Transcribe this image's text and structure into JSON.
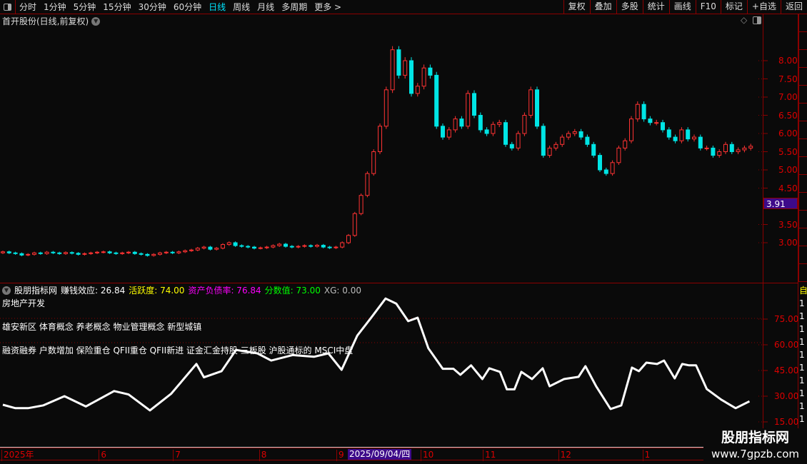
{
  "toolbar": {
    "periods": [
      "分时",
      "1分钟",
      "5分钟",
      "15分钟",
      "30分钟",
      "60分钟",
      "日线",
      "周线",
      "月线",
      "多周期",
      "更多 >"
    ],
    "active_period": "日线",
    "buttons": [
      "复权",
      "叠加",
      "多股",
      "统计",
      "画线",
      "F10",
      "标记",
      "+自选",
      "返回"
    ]
  },
  "stock_title": "首开股份(日线,前复权)",
  "price_axis": {
    "ticks": [
      "8.00",
      "7.50",
      "7.00",
      "6.50",
      "6.00",
      "5.50",
      "5.00",
      "4.50",
      "3.50",
      "3.00"
    ],
    "current": "3.91"
  },
  "indicator": {
    "name": "股朋指标网",
    "items": [
      {
        "label": "赚钱效应: 26.84",
        "color": "#ffffff"
      },
      {
        "label": "活跃度: 74.00",
        "color": "#ffff00"
      },
      {
        "label": "资产负债率: 76.84",
        "color": "#ff00ff"
      },
      {
        "label": "分数值: 73.00",
        "color": "#00ff00"
      },
      {
        "label": "XG: 0.00",
        "color": "#bbbbbb"
      }
    ],
    "lines": [
      "房地产开发",
      "雄安新区 体育概念 养老概念 物业管理概念 新型城镇",
      "融资融券 户数增加 保险重仓 QFII重仓 QFII新进 证金汇金持股 三板股 沪股通标的 MSCI中盘"
    ],
    "ticks": [
      "75.00",
      "60.00",
      "45.00",
      "30.00",
      "15.00"
    ],
    "right_col": [
      "自",
      "1",
      "1",
      "1",
      "1",
      "1",
      "1",
      "1",
      "1",
      "1",
      "1"
    ]
  },
  "time_axis": {
    "labels": [
      {
        "t": "2025年",
        "p": 0
      },
      {
        "t": "6",
        "p": 15.5
      },
      {
        "t": "7",
        "p": 27.3
      },
      {
        "t": "8",
        "p": 41
      },
      {
        "t": "9",
        "p": 53.3
      },
      {
        "t": "10",
        "p": 66.7
      },
      {
        "t": "11",
        "p": 76.6
      },
      {
        "t": "12",
        "p": 88.6
      },
      {
        "t": "1",
        "p": 102
      }
    ],
    "crosshair_date": "2025/09/04/四"
  },
  "watermark": {
    "title": "股朋指标网",
    "url": "www.7gpzb.com"
  },
  "colors": {
    "up": "#ff3333",
    "down": "#00e5e5",
    "accent": "#00e5ff",
    "grid": "#8b0000",
    "highlight": "#3d0a8a"
  },
  "chart_data": {
    "type": "candlestick",
    "closes": [
      2.75,
      2.72,
      2.7,
      2.66,
      2.68,
      2.72,
      2.7,
      2.74,
      2.72,
      2.7,
      2.73,
      2.71,
      2.68,
      2.7,
      2.72,
      2.74,
      2.75,
      2.72,
      2.7,
      2.72,
      2.74,
      2.7,
      2.68,
      2.65,
      2.68,
      2.72,
      2.74,
      2.72,
      2.75,
      2.78,
      2.8,
      2.85,
      2.88,
      2.82,
      2.85,
      2.95,
      3.0,
      2.92,
      2.9,
      2.88,
      2.85,
      2.86,
      2.88,
      2.92,
      2.96,
      2.9,
      2.88,
      2.9,
      2.92,
      2.9,
      2.93,
      2.88,
      2.86,
      2.88,
      3.0,
      3.2,
      3.8,
      4.3,
      4.9,
      5.5,
      6.2,
      7.2,
      8.3,
      7.6,
      8.0,
      7.1,
      7.3,
      7.8,
      7.6,
      6.2,
      5.9,
      6.1,
      6.4,
      6.2,
      7.1,
      6.5,
      6.1,
      6.0,
      6.25,
      6.3,
      5.7,
      5.6,
      6.0,
      6.5,
      7.2,
      6.2,
      5.4,
      5.6,
      5.7,
      5.9,
      6.0,
      6.05,
      5.9,
      5.7,
      5.4,
      5.0,
      4.9,
      5.2,
      5.6,
      5.8,
      6.4,
      6.8,
      6.4,
      6.3,
      6.3,
      6.1,
      5.9,
      5.8,
      6.1,
      5.85,
      5.9,
      5.6,
      5.6,
      5.4,
      5.5,
      5.7,
      5.5,
      5.55,
      5.6,
      5.65
    ],
    "price_range": [
      2.5,
      8.5
    ],
    "indicator_line": [
      [
        0,
        25
      ],
      [
        2,
        23
      ],
      [
        4,
        23
      ],
      [
        6.4,
        24.6
      ],
      [
        9.8,
        30
      ],
      [
        13.2,
        24
      ],
      [
        17.7,
        33
      ],
      [
        20,
        31
      ],
      [
        23.4,
        21.7
      ],
      [
        26.8,
        31.5
      ],
      [
        30.8,
        48.8
      ],
      [
        32,
        41
      ],
      [
        34.8,
        44.6
      ],
      [
        37.1,
        57
      ],
      [
        40.5,
        55
      ],
      [
        42.7,
        50.8
      ],
      [
        46.1,
        54
      ],
      [
        49.5,
        53
      ],
      [
        51.8,
        55
      ],
      [
        53.9,
        45.4
      ],
      [
        56.4,
        65.4
      ],
      [
        58.6,
        75.8
      ],
      [
        60.9,
        87
      ],
      [
        62.6,
        84
      ],
      [
        64.5,
        73.8
      ],
      [
        66,
        75.8
      ],
      [
        67.7,
        58
      ],
      [
        70,
        46
      ],
      [
        71.7,
        46
      ],
      [
        72.8,
        42.5
      ],
      [
        74.5,
        48
      ],
      [
        76.3,
        40
      ],
      [
        77.4,
        46.3
      ],
      [
        79.1,
        44.2
      ],
      [
        80.2,
        34
      ],
      [
        81.4,
        34
      ],
      [
        82.5,
        44.2
      ],
      [
        84.2,
        40
      ],
      [
        85.9,
        46.3
      ],
      [
        87,
        35.8
      ],
      [
        89.3,
        40
      ],
      [
        91.6,
        41.3
      ],
      [
        92.7,
        47.5
      ],
      [
        94.4,
        35.8
      ],
      [
        96.7,
        22.5
      ],
      [
        98.4,
        24.6
      ],
      [
        100.1,
        46.7
      ],
      [
        101.2,
        44.6
      ],
      [
        102.4,
        49.6
      ],
      [
        104.1,
        48.8
      ],
      [
        105.2,
        50.8
      ],
      [
        106.9,
        40.4
      ],
      [
        108.1,
        48.8
      ],
      [
        109.2,
        48
      ],
      [
        110.3,
        48
      ],
      [
        112,
        34.2
      ],
      [
        114.3,
        28
      ],
      [
        116.6,
        23
      ],
      [
        118.8,
        27
      ]
    ],
    "indicator_range": [
      10,
      95
    ]
  }
}
